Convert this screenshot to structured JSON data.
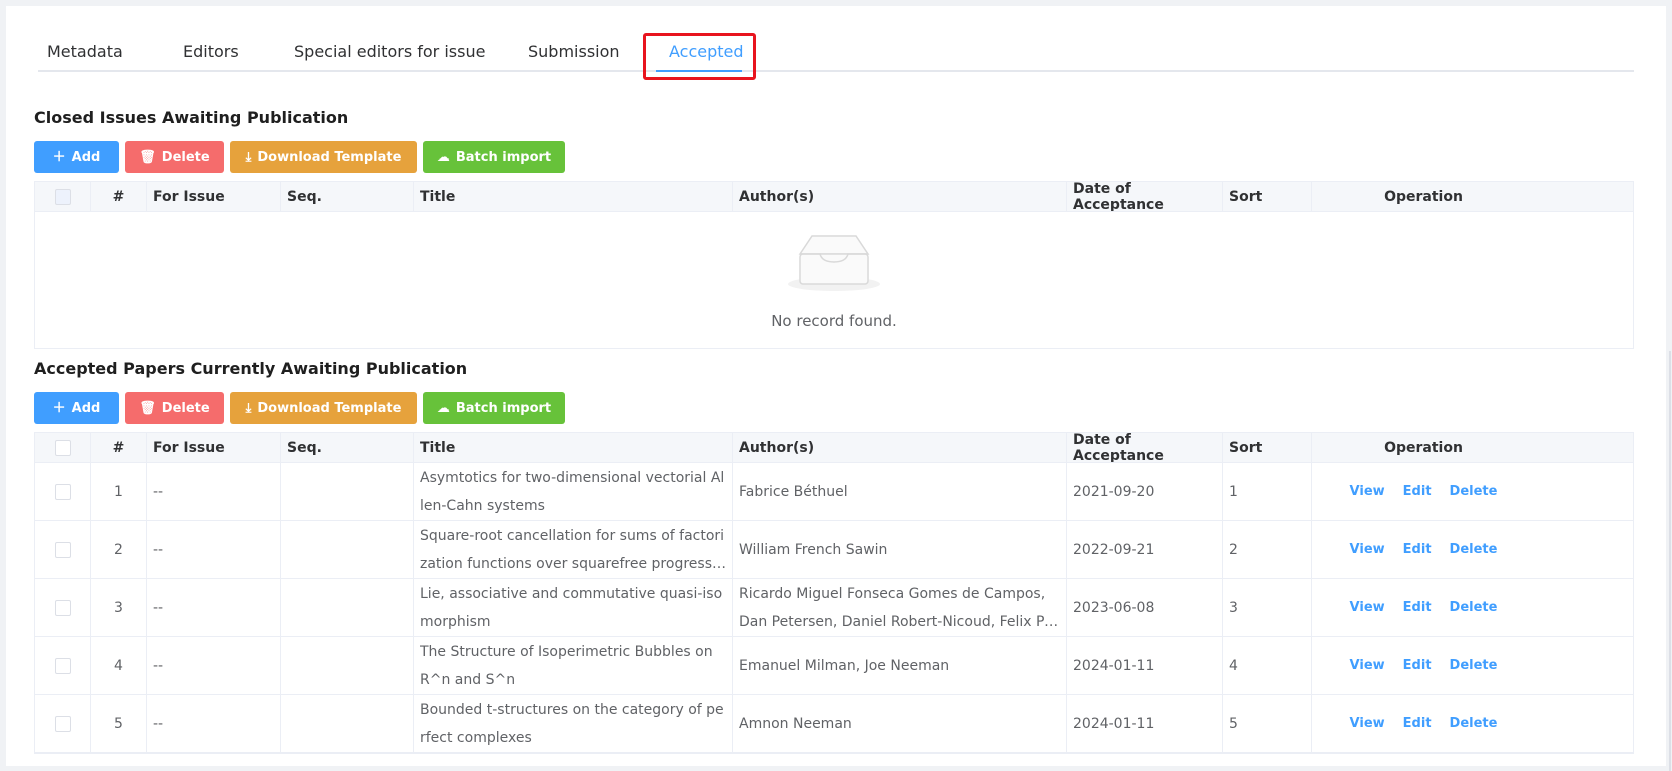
{
  "tabs": [
    {
      "label": "Metadata"
    },
    {
      "label": "Editors"
    },
    {
      "label": "Special editors for issue"
    },
    {
      "label": "Submission"
    },
    {
      "label": "Accepted"
    }
  ],
  "buttons": {
    "add": "Add",
    "delete": "Delete",
    "download_template": "Download Template",
    "batch_import": "Batch import"
  },
  "columns": [
    "#",
    "For Issue",
    "Seq.",
    "Title",
    "Author(s)",
    "Date of Acceptance",
    "Sort",
    "Operation"
  ],
  "closed_issues": {
    "title": "Closed Issues Awaiting Publication",
    "empty_text": "No record found."
  },
  "accepted_papers": {
    "title": "Accepted Papers Currently Awaiting Publication",
    "rows": [
      {
        "num": "1",
        "issue": "--",
        "seq": "",
        "title": "Asymtotics for two-dimensional vectorial Allen-Cahn systems",
        "authors": "Fabrice Béthuel",
        "date": "2021-09-20",
        "sort": "1"
      },
      {
        "num": "2",
        "issue": "--",
        "seq": "",
        "title": "Square-root cancellation for sums of factorization functions over squarefree progressions in F...",
        "authors": "William French Sawin",
        "date": "2022-09-21",
        "sort": "2"
      },
      {
        "num": "3",
        "issue": "--",
        "seq": "",
        "title": "Lie, associative and commutative quasi-isomorphism",
        "authors": "Ricardo Miguel Fonseca Gomes de Campos, Dan Petersen, Daniel Robert-Nicoud, Felix Pieter Wiers...",
        "date": "2023-06-08",
        "sort": "3"
      },
      {
        "num": "4",
        "issue": "--",
        "seq": "",
        "title": "The Structure of Isoperimetric Bubbles on R^n and S^n",
        "authors": "Emanuel Milman, Joe Neeman",
        "date": "2024-01-11",
        "sort": "4"
      },
      {
        "num": "5",
        "issue": "--",
        "seq": "",
        "title": "Bounded t-structures on the category of perfect complexes",
        "authors": "Amnon Neeman",
        "date": "2024-01-11",
        "sort": "5"
      }
    ]
  },
  "operations": {
    "view": "View",
    "edit": "Edit",
    "delete": "Delete"
  }
}
